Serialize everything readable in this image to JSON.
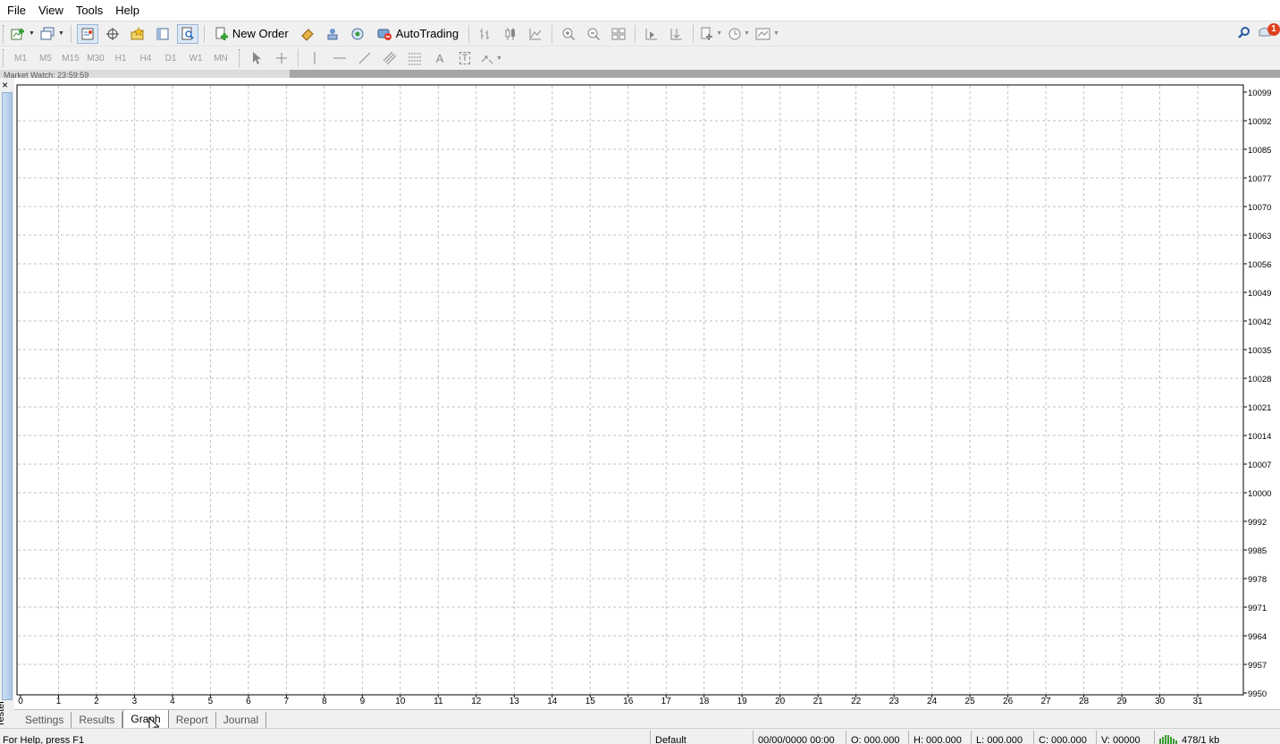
{
  "menu": {
    "items": [
      "File",
      "View",
      "Tools",
      "Help"
    ]
  },
  "toolbar": {
    "new_order_label": "New Order",
    "autotrading_label": "AutoTrading",
    "icons": [
      "new-chart-icon",
      "profiles-icon",
      "market-watch-icon",
      "data-window-icon",
      "favorites-icon",
      "navigator-icon",
      "terminal-icon",
      "strategy-tester-icon",
      "new-order-icon",
      "metaeditor-icon",
      "signals-icon",
      "autotrading-icon",
      "bar-chart-icon",
      "candlestick-icon",
      "line-chart-icon",
      "zoom-in-icon",
      "zoom-out-icon",
      "tile-windows-icon",
      "chart-shift-icon",
      "autoscroll-icon",
      "indicators-icon",
      "periodicity-icon",
      "templates-icon",
      "search-icon",
      "news-icon"
    ]
  },
  "timeframes": [
    "M1",
    "M5",
    "M15",
    "M30",
    "H1",
    "H4",
    "D1",
    "W1",
    "MN"
  ],
  "drawing_tools": {
    "text_tool": "A",
    "label_tool": "T"
  },
  "market_watch_strip": "Market Watch: 23:59:59",
  "notification_count": "1",
  "tester": {
    "close_label": "×",
    "side_label": "Tester",
    "tabs": [
      "Settings",
      "Results",
      "Graph",
      "Report",
      "Journal"
    ],
    "active_tab": "Graph"
  },
  "chart_data": {
    "type": "line",
    "title": "",
    "xlabel": "",
    "ylabel": "",
    "x": [
      0,
      1,
      2,
      3,
      4,
      5,
      6,
      7,
      8,
      9,
      10,
      11,
      12,
      13,
      14,
      15,
      16,
      17,
      18,
      19,
      20,
      21,
      22,
      23,
      24,
      25,
      26,
      27,
      28,
      29,
      30,
      31
    ],
    "xlim": [
      0,
      31
    ],
    "ylim": [
      9950,
      10099
    ],
    "y_ticks": [
      "10099",
      "10092",
      "10085",
      "10077",
      "10070",
      "10063",
      "10056",
      "10049",
      "10042",
      "10035",
      "10028",
      "10021",
      "10014",
      "10007",
      "10000",
      "9992",
      "9985",
      "9978",
      "9971",
      "9964",
      "9957",
      "9950"
    ],
    "series": [],
    "grid": true,
    "grid_style": "dashed"
  },
  "status": {
    "help": "For Help, press F1",
    "profile": "Default",
    "datetime": "00/00/0000 00:00",
    "open": "O: 000.000",
    "high": "H: 000.000",
    "low": "L: 000.000",
    "close": "C: 000.000",
    "volume": "V: 00000",
    "traffic": "478/1 kb"
  },
  "colors": {
    "grid": "#c0c0c0",
    "chart_bg": "#ffffff",
    "notification": "#e04020",
    "active_tab_border": "#8a8a8a"
  }
}
